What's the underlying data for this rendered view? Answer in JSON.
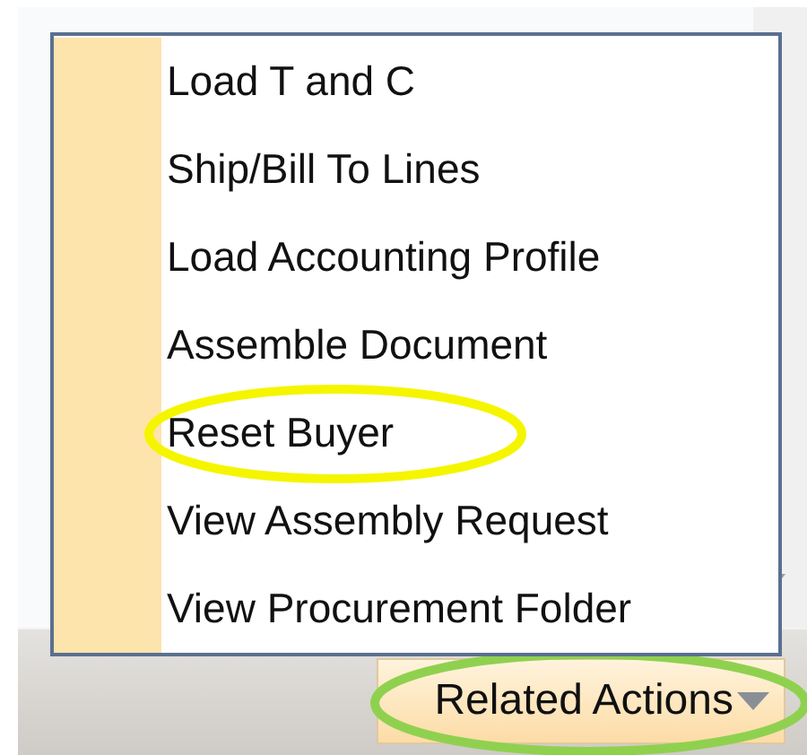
{
  "menu": {
    "items": [
      {
        "label": "Load T and C",
        "circled": false
      },
      {
        "label": "Ship/Bill To Lines",
        "circled": false
      },
      {
        "label": "Load Accounting Profile",
        "circled": false
      },
      {
        "label": "Assemble Document",
        "circled": false
      },
      {
        "label": "Reset Buyer",
        "circled": true
      },
      {
        "label": "View Assembly Request",
        "circled": false
      },
      {
        "label": "View Procurement Folder",
        "circled": false
      }
    ]
  },
  "button": {
    "label": "Related Actions",
    "circled": true
  }
}
